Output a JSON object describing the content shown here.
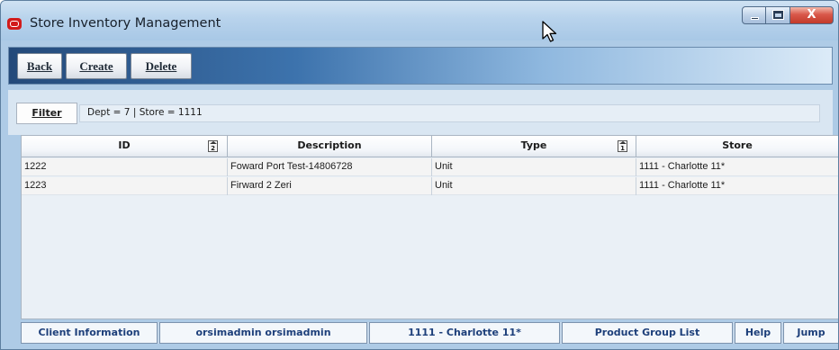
{
  "window": {
    "title": "Store Inventory Management",
    "controls": {
      "minimize": "minimize",
      "maximize": "maximize",
      "close": "X"
    }
  },
  "toolbar": {
    "back_label": "Back",
    "create_label": "Create",
    "delete_label": "Delete"
  },
  "filter": {
    "button_label": "Filter",
    "summary": "Dept = 7 | Store = 1111"
  },
  "grid": {
    "columns": [
      "ID",
      "Description",
      "Type",
      "Store"
    ],
    "sort_badges": {
      "id": "2",
      "type": "1"
    },
    "rows": [
      {
        "id": "1222",
        "description": "Foward Port Test-14806728",
        "type": "Unit",
        "store": "1111 - Charlotte 11*"
      },
      {
        "id": "1223",
        "description": "Firward 2  Zeri",
        "type": "Unit",
        "store": "1111 - Charlotte 11*"
      }
    ]
  },
  "statusbar": {
    "client_info": "Client Information",
    "user": "orsimadmin orsimadmin",
    "store": "1111 - Charlotte 11*",
    "product_group_list": "Product Group List",
    "help": "Help",
    "jump": "Jump"
  },
  "colors": {
    "title_gradient": "#b8d3ec",
    "toolbar_dark": "#244a7a",
    "close_button": "#d9584a",
    "status_text": "#1d3f7a",
    "app_icon": "#d21b1b"
  }
}
